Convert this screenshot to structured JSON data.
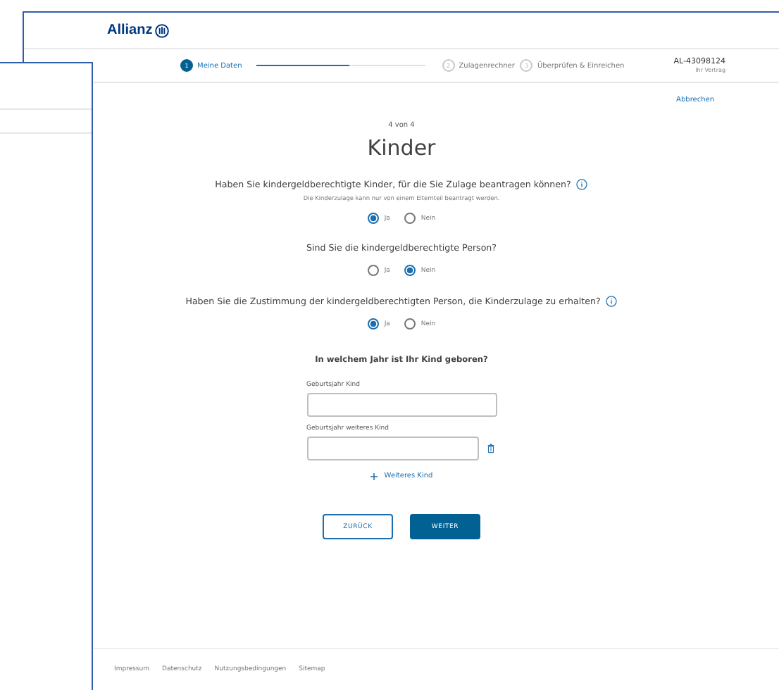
{
  "page": {
    "logo": "Allianz",
    "stepper": {
      "steps": [
        {
          "number": "1",
          "label": "Meine Daten",
          "active": true
        },
        {
          "number": "2",
          "label": "Zulagenrechner",
          "active": false
        },
        {
          "number": "3",
          "label": "Überprüfen & Einreichen",
          "active": false
        }
      ],
      "progress": {
        "level": 0.55
      }
    },
    "contract": {
      "number": "AL-43098124",
      "caption": "Ihr Vertrag"
    },
    "cancel_link": "Abbrechen",
    "step_counter": "4 von 4",
    "heading": "Kinder",
    "questions": [
      {
        "text": "Haben Sie kindergeldberechtigte Kinder, für die Sie Zulage beantragen können?",
        "info": true,
        "hint": "Die Kinderzulage kann nur von einem Elternteil beantragt werden.",
        "options": [
          {
            "label": "Ja",
            "selected": true
          },
          {
            "label": "Nein",
            "selected": false
          }
        ]
      },
      {
        "text": "Sind Sie die kindergeldberechtigte Person?",
        "info": false,
        "options": [
          {
            "label": "Ja",
            "selected": false
          },
          {
            "label": "Nein",
            "selected": true
          }
        ]
      },
      {
        "text": "Haben Sie die Zustimmung der kindergeldberechtigten Person, die Kinderzulage zu erhalten?",
        "info": true,
        "options": [
          {
            "label": "Ja",
            "selected": true
          },
          {
            "label": "Nein",
            "selected": false
          }
        ]
      }
    ],
    "birth_year": {
      "question": "In welchem Jahr ist Ihr Kind geboren?",
      "fields": [
        {
          "label": "Geburtsjahr Kind",
          "removable": false
        },
        {
          "label": "Geburtsjahr weiteres Kind",
          "removable": true
        }
      ],
      "add_link": "Weiteres Kind"
    },
    "buttons": [
      {
        "label": "ZURÜCK",
        "kind": "secondary"
      },
      {
        "label": "WEITER",
        "kind": "primary"
      }
    ],
    "footer_links": [
      "Impressum",
      "Datenschutz",
      "Nutzungsbedingungen",
      "Sitemap"
    ]
  }
}
